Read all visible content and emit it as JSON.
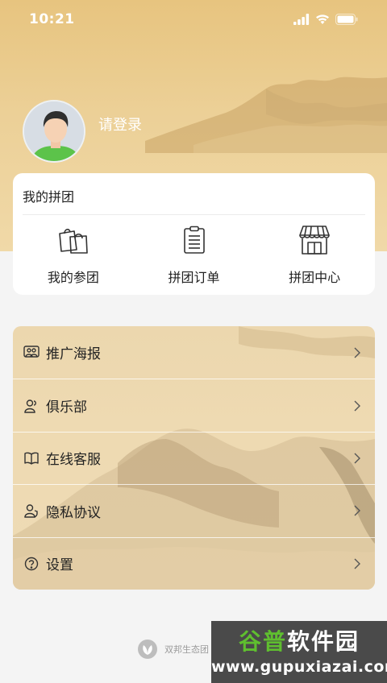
{
  "status_bar": {
    "time": "10:21"
  },
  "profile": {
    "login_label": "请登录"
  },
  "group": {
    "title": "我的拼团",
    "items": [
      {
        "label": "我的参团",
        "icon": "shopping-bags-icon"
      },
      {
        "label": "拼团订单",
        "icon": "clipboard-list-icon"
      },
      {
        "label": "拼团中心",
        "icon": "storefront-icon"
      }
    ]
  },
  "menu": {
    "items": [
      {
        "label": "推广海报",
        "icon": "people-share-icon"
      },
      {
        "label": "俱乐部",
        "icon": "users-icon"
      },
      {
        "label": "在线客服",
        "icon": "book-service-icon"
      },
      {
        "label": "隐私协议",
        "icon": "user-shield-icon"
      },
      {
        "label": "设置",
        "icon": "help-circle-icon"
      }
    ]
  },
  "footer": {
    "brand": "双邦生态团"
  },
  "watermark": {
    "title_prefix": "谷普",
    "title_rest": "软件园",
    "url": "www.gupuxiazai.com"
  },
  "colors": {
    "hero": "#e7c47f",
    "card": "#ffffff",
    "accent_green": "#5fbf2f"
  }
}
